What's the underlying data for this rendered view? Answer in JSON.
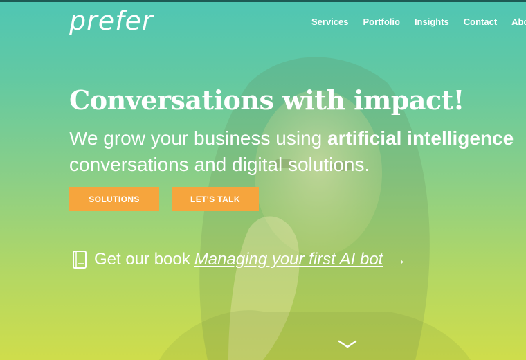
{
  "brand": {
    "logo_text": "prefer"
  },
  "nav": {
    "items": [
      {
        "label": "Services"
      },
      {
        "label": "Portfolio"
      },
      {
        "label": "Insights"
      },
      {
        "label": "Contact"
      },
      {
        "label": "About us"
      }
    ]
  },
  "hero": {
    "headline": "Conversations with impact!",
    "sub_pre": "We grow your business using ",
    "sub_bold": "artificial intelligence",
    "sub_post": "conversations and digital solutions.",
    "btn_solutions": "SOLUTIONS",
    "btn_talk": "LET'S TALK",
    "book_prefix": "Get our book",
    "book_link": "Managing your first AI bot",
    "book_arrow": "→"
  },
  "colors": {
    "gradient_top": "#4fc6b4",
    "gradient_bottom": "#cfdd4b",
    "button": "#f6a53d"
  },
  "icons": [
    "book-icon",
    "arrow-right-icon",
    "chevron-down-icon"
  ]
}
